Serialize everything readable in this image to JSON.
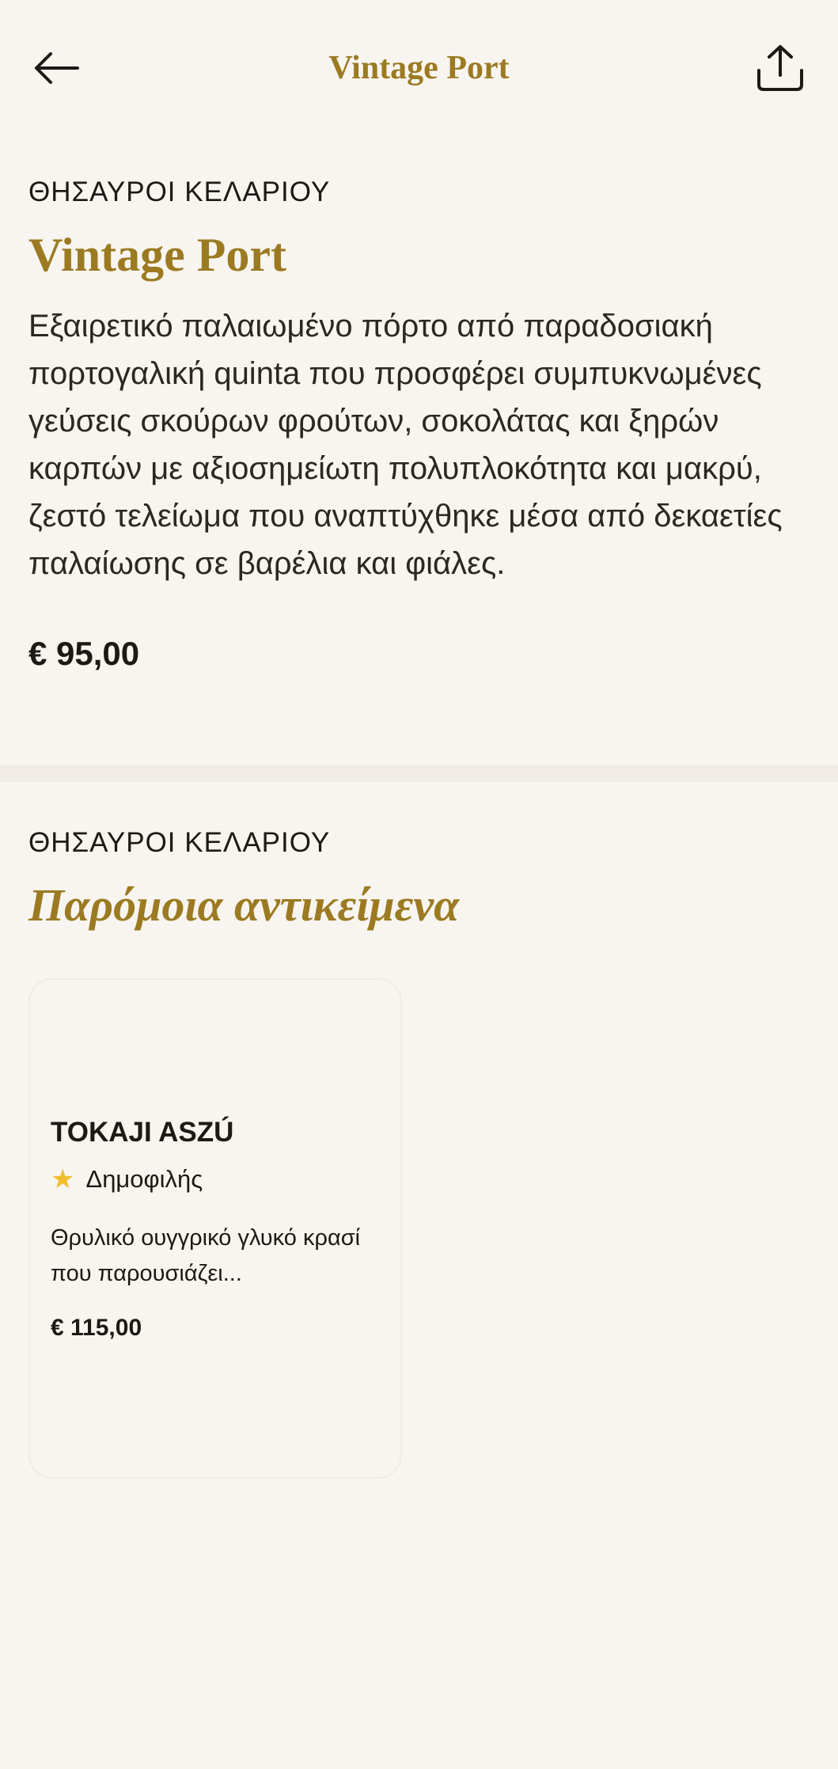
{
  "header": {
    "title": "Vintage Port",
    "back_icon": "arrow-left-icon",
    "share_icon": "share-icon"
  },
  "product": {
    "eyebrow": "ΘΗΣΑΥΡΟΙ ΚΕΛΑΡΙΟΥ",
    "title": "Vintage Port",
    "description": "Εξαιρετικό παλαιωμένο πόρτο από παραδοσιακή πορτογαλική quinta που προσφέρει συμπυκνωμένες γεύσεις σκούρων φρούτων, σοκολάτας και ξηρών καρπών με αξιοσημείωτη πολυπλοκότητα και μακρύ, ζεστό τελείωμα που αναπτύχθηκε μέσα από δεκαετίες παλαίωσης σε βαρέλια και φιάλες.",
    "price": "€ 95,00"
  },
  "similar": {
    "eyebrow": "ΘΗΣΑΥΡΟΙ ΚΕΛΑΡΙΟΥ",
    "title": "Παρόμοια αντικείμενα",
    "items": [
      {
        "name": "TOKAJI ASZÚ",
        "badge": "Δημοφιλής",
        "badge_icon": "star-icon",
        "description": "Θρυλικό ουγγρικό γλυκό κρασί που παρουσιάζει...",
        "price": "€ 115,00"
      }
    ]
  },
  "colors": {
    "background": "#f8f5f0",
    "accent_gold": "#9b7a22",
    "star": "#f1be2f",
    "text": "#1c1a14"
  }
}
